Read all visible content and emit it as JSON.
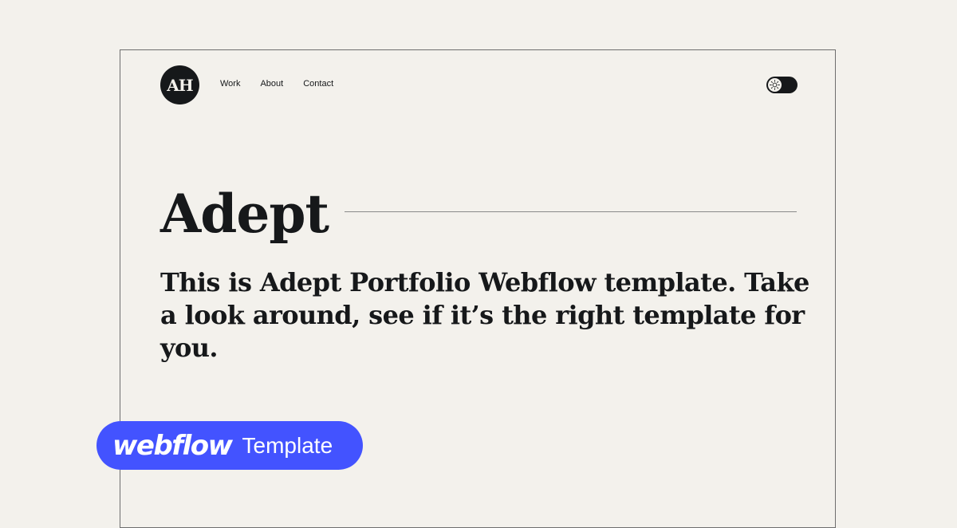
{
  "logo": {
    "text": "AH"
  },
  "nav": {
    "items": [
      {
        "label": "Work"
      },
      {
        "label": "About"
      },
      {
        "label": "Contact"
      }
    ]
  },
  "theme_toggle": {
    "icon": "sun-icon"
  },
  "hero": {
    "title": "Adept",
    "text": "This is Adept Portfolio Webflow template. Take a look around, see if it’s the right template for you."
  },
  "badge": {
    "brand": "webflow",
    "label": "Template"
  },
  "colors": {
    "background": "#f3f1ec",
    "text": "#16181a",
    "badge": "#4353ff"
  }
}
